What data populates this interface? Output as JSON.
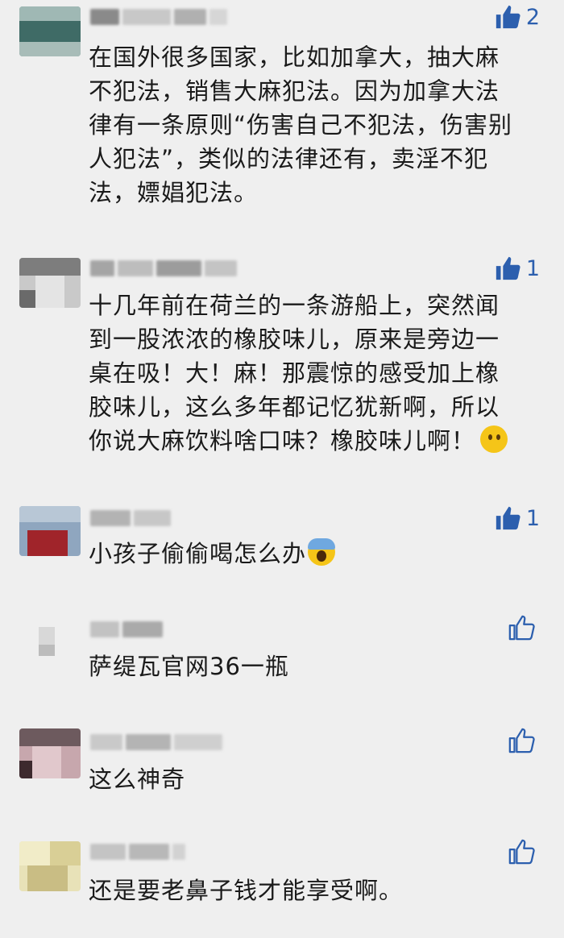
{
  "comments": [
    {
      "likes": "2",
      "liked": true,
      "text": "在国外很多国家，比如加拿大，抽大麻\n不犯法，销售大麻犯法。因为加拿大法\n律有一条原则“伤害自己不犯法，伤害别\n人犯法”，类似的法律还有，卖淫不犯\n法，嫖娼犯法。"
    },
    {
      "likes": "1",
      "liked": true,
      "text": "十几年前在荷兰的一条游船上，突然闻\n到一股浓浓的橡胶味儿，原来是旁边一\n桌在吸！大！麻！那震惊的感受加上橡\n胶味儿，这么多年都记忆犹新啊，所以\n你说大麻饮料啥口味？橡胶味儿啊！",
      "emoji": "thinking-face-emoji"
    },
    {
      "likes": "1",
      "liked": true,
      "text": "小孩子偷偷喝怎么办",
      "emoji": "screaming-face-emoji"
    },
    {
      "likes": "",
      "liked": false,
      "text": "萨缇瓦官网36一瓶"
    },
    {
      "likes": "",
      "liked": false,
      "text": "这么神奇"
    },
    {
      "likes": "",
      "liked": false,
      "text": "还是要老鼻子钱才能享受啊。"
    }
  ],
  "colors": {
    "background": "#efefef",
    "like_accent": "#2c5fae",
    "text": "#1a1a1a"
  },
  "icons": {
    "like": "thumbs-up-icon"
  }
}
